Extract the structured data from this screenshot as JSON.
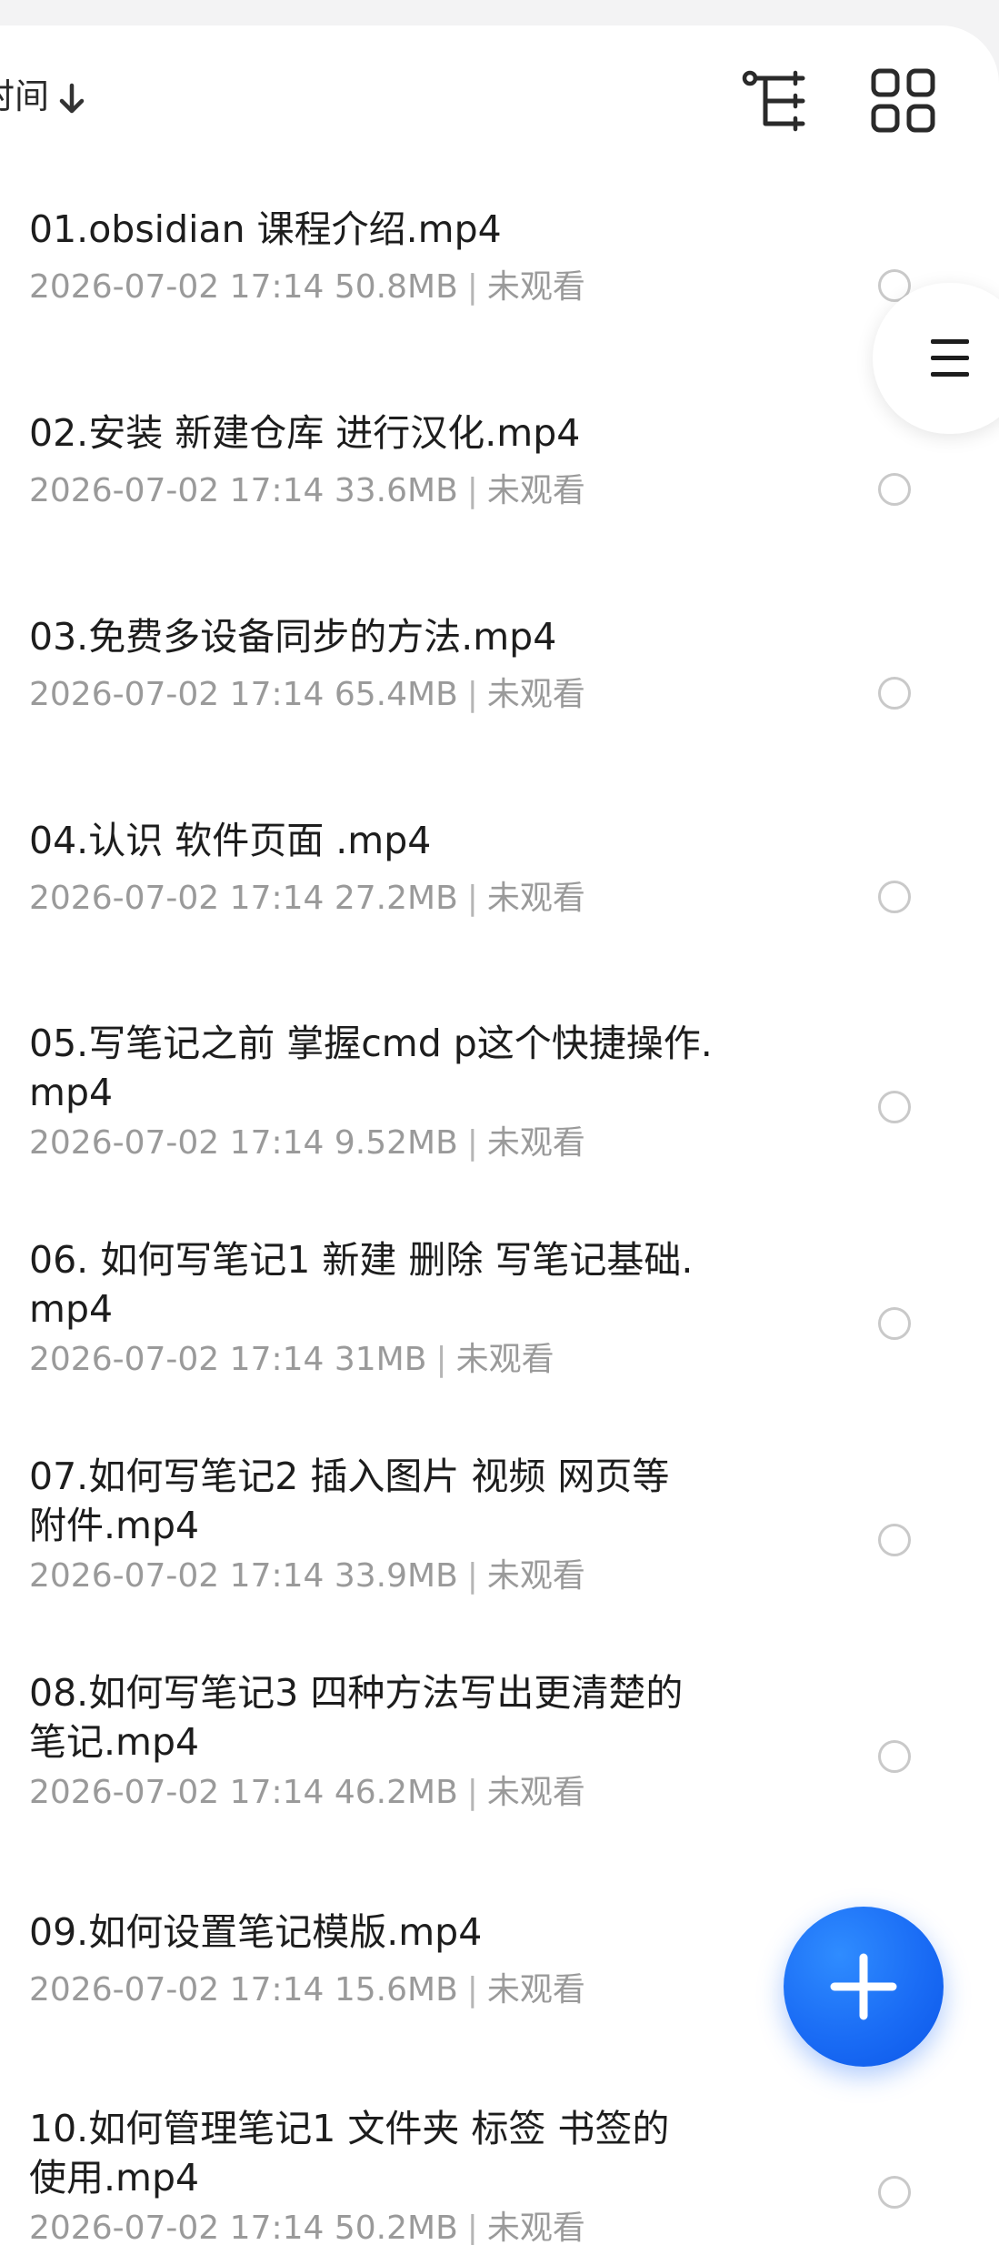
{
  "toolbar": {
    "sort_label": "时间",
    "sort_direction_icon": "arrow-down-icon",
    "tree_view_icon": "tree-view-icon",
    "grid_view_icon": "grid-view-icon"
  },
  "files": [
    {
      "name": "01.obsidian 课程介绍.mp4",
      "date": "2026-07-02 17:14",
      "size": "50.8MB",
      "status": "未观看"
    },
    {
      "name": "02.安装 新建仓库 进行汉化.mp4",
      "date": "2026-07-02 17:14",
      "size": "33.6MB",
      "status": "未观看"
    },
    {
      "name": "03.免费多设备同步的方法.mp4",
      "date": "2026-07-02 17:14",
      "size": "65.4MB",
      "status": "未观看"
    },
    {
      "name": "04.认识 软件页面 .mp4",
      "date": "2026-07-02 17:14",
      "size": "27.2MB",
      "status": "未观看"
    },
    {
      "name": "05.写笔记之前 掌握cmd p这个快捷操作.mp4",
      "date": "2026-07-02 17:14",
      "size": "9.52MB",
      "status": "未观看"
    },
    {
      "name": "06. 如何写笔记1  新建 删除 写笔记基础.mp4",
      "date": "2026-07-02 17:14",
      "size": "31MB",
      "status": "未观看"
    },
    {
      "name": "07.如何写笔记2 插入图片 视频 网页等附件.mp4",
      "date": "2026-07-02 17:14",
      "size": "33.9MB",
      "status": "未观看"
    },
    {
      "name": "08.如何写笔记3 四种方法写出更清楚的笔记.mp4",
      "date": "2026-07-02 17:14",
      "size": "46.2MB",
      "status": "未观看"
    },
    {
      "name": "09.如何设置笔记模版.mp4",
      "date": "2026-07-02 17:14",
      "size": "15.6MB",
      "status": "未观看"
    },
    {
      "name": "10.如何管理笔记1 文件夹 标签 书签的使用.mp4",
      "date": "2026-07-02 17:14",
      "size": "50.2MB",
      "status": "未观看"
    }
  ],
  "title_lines": [
    [
      "01.obsidian 课程介绍.mp4"
    ],
    [
      "02.安装 新建仓库 进行汉化.mp4"
    ],
    [
      "03.免费多设备同步的方法.mp4"
    ],
    [
      "04.认识 软件页面 .mp4"
    ],
    [
      "05.写笔记之前 掌握cmd p这个快捷操作.",
      "mp4"
    ],
    [
      "06. 如何写笔记1  新建 删除 写笔记基础.",
      "mp4"
    ],
    [
      "07.如何写笔记2 插入图片 视频 网页等",
      "附件.mp4"
    ],
    [
      "08.如何写笔记3 四种方法写出更清楚的",
      "笔记.mp4"
    ],
    [
      "09.如何设置笔记模版.mp4"
    ],
    [
      "10.如何管理笔记1 文件夹 标签 书签的",
      "使用.mp4"
    ]
  ],
  "side_menu": {
    "icon": "menu-icon"
  },
  "fab": {
    "icon": "plus-icon",
    "color": "#1a6cf5"
  },
  "colors": {
    "title": "#1d1d1d",
    "meta": "#9a9a9a",
    "radio_border": "#c9c9c9",
    "background": "#f3f3f4"
  }
}
